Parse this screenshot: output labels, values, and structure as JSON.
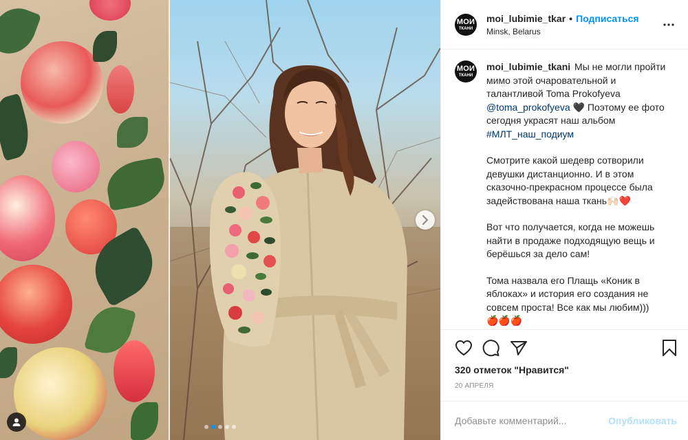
{
  "header": {
    "username": "moi_lubimie_tkar",
    "separator": "•",
    "follow_label": "Подписаться",
    "location": "Minsk, Belarus",
    "avatar_line1": "МОИ",
    "avatar_line2": "ТКАНИ",
    "more_icon": "more-horizontal-icon"
  },
  "caption": {
    "username": "moi_lubimie_tkani",
    "text1": "Мы не могли пройти мимо этой очаровательной и талантливой Toma Prokofyeva",
    "mention": "@toma_prokofyeva",
    "text2": "🖤 Поэтому ее фото сегодня украсят наш альбом",
    "hashtag": "#МЛТ_наш_подиум",
    "para2": "Смотрите какой шедевр сотворили девушки дистанционно. И в этом сказочно-прекрасном процессе была задействована наша ткань🙌🏻❤️",
    "para3": "Вот что получается, когда не можешь найти в продаже подходящую вещь и берёшься за дело сам!",
    "para4": "Тома назвала его Плащь «Коник в яблоках» и история его создания не совсем проста! Все как мы любим)))",
    "para5": "🍎🍎🍎"
  },
  "actions": {
    "likes": "320 отметок \"Нравится\"",
    "date": "20 АПРЕЛЯ"
  },
  "comment": {
    "placeholder": "Добавьте комментарий...",
    "publish_label": "Опубликовать"
  },
  "carousel": {
    "slide_count": 5,
    "active_index": 1
  },
  "colors": {
    "accent": "#0095f6",
    "link": "#00376b",
    "muted": "#8e8e8e",
    "publish_disabled": "#b2dffc"
  }
}
